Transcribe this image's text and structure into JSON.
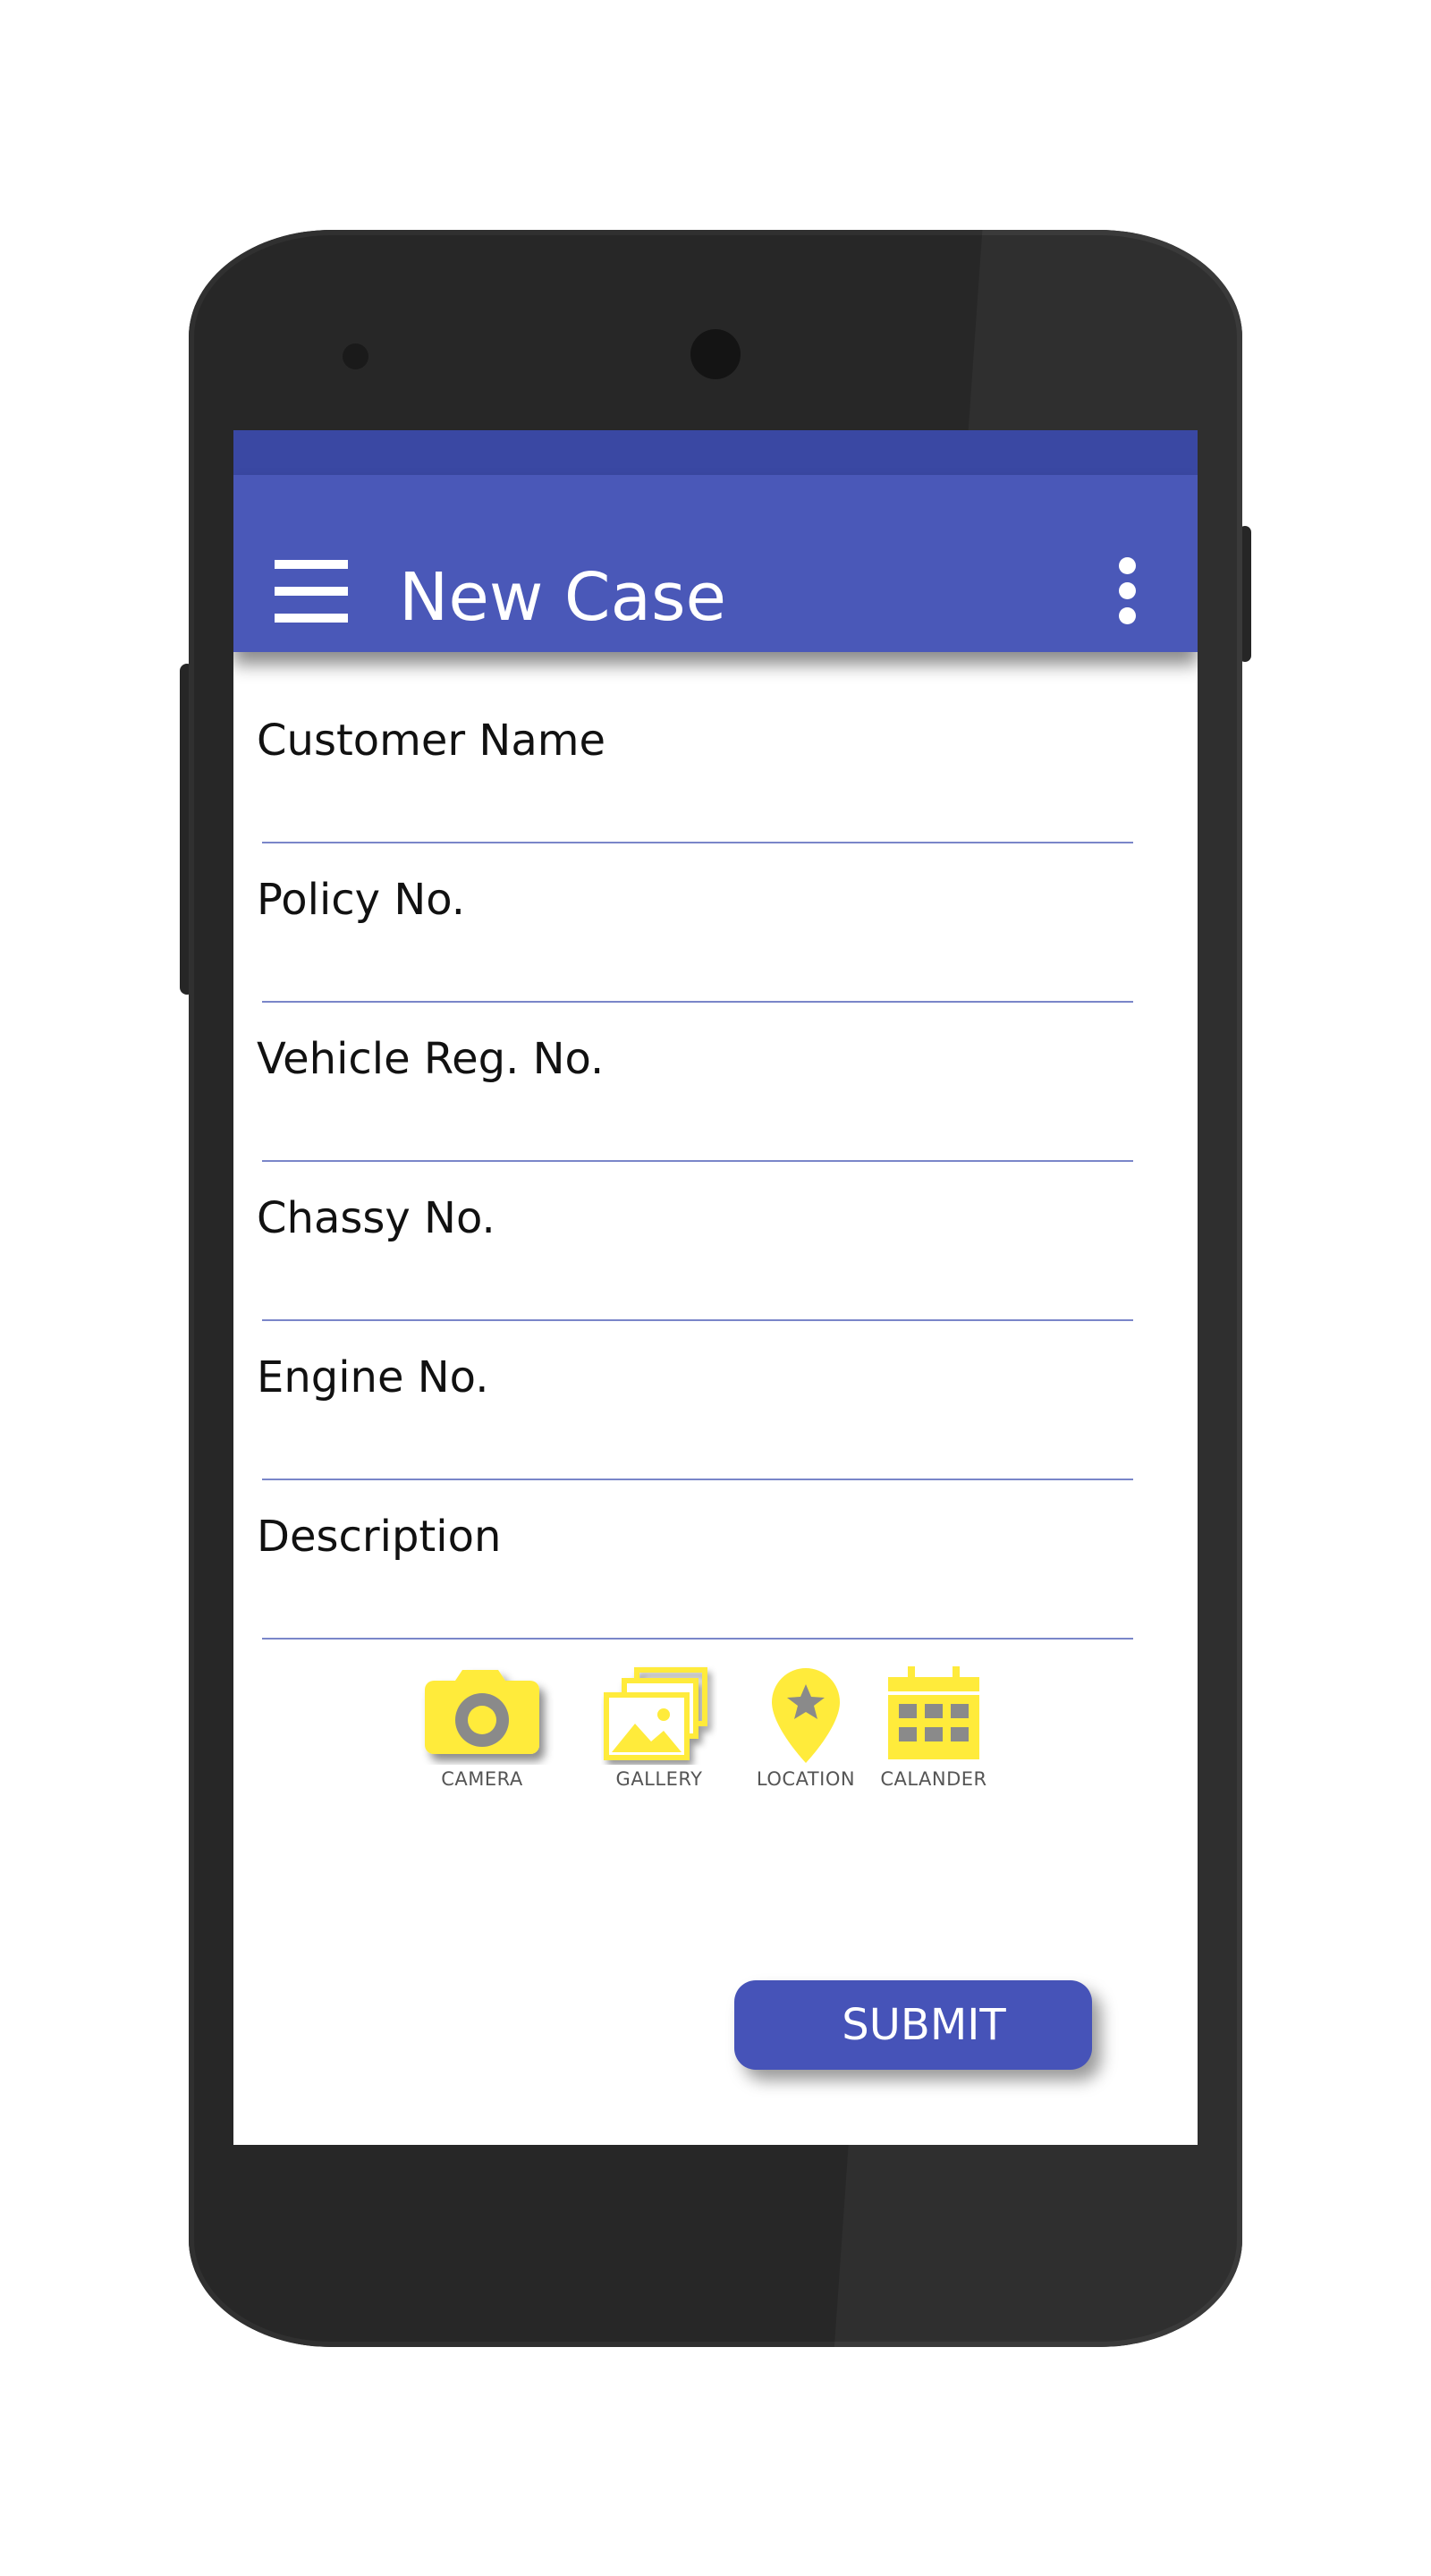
{
  "app": {
    "title": "New Case",
    "accent_color": "#4a58b8",
    "status_bar_color": "#3a48a3",
    "tool_icon_color": "#ffeb3b"
  },
  "app_bar": {
    "menu_icon": "hamburger-menu-icon",
    "more_icon": "more-vertical-icon"
  },
  "form": {
    "fields": [
      {
        "label": "Customer Name",
        "value": ""
      },
      {
        "label": "Policy No.",
        "value": ""
      },
      {
        "label": "Vehicle Reg. No.",
        "value": ""
      },
      {
        "label": "Chassy No.",
        "value": ""
      },
      {
        "label": "Engine No.",
        "value": ""
      },
      {
        "label": "Description",
        "value": ""
      }
    ]
  },
  "tools": [
    {
      "label": "CAMERA",
      "icon": "camera-icon"
    },
    {
      "label": "GALLERY",
      "icon": "gallery-icon"
    },
    {
      "label": "LOCATION",
      "icon": "location-icon"
    },
    {
      "label": "CALANDER",
      "icon": "calendar-icon"
    }
  ],
  "actions": {
    "submit_label": "SUBMIT"
  }
}
